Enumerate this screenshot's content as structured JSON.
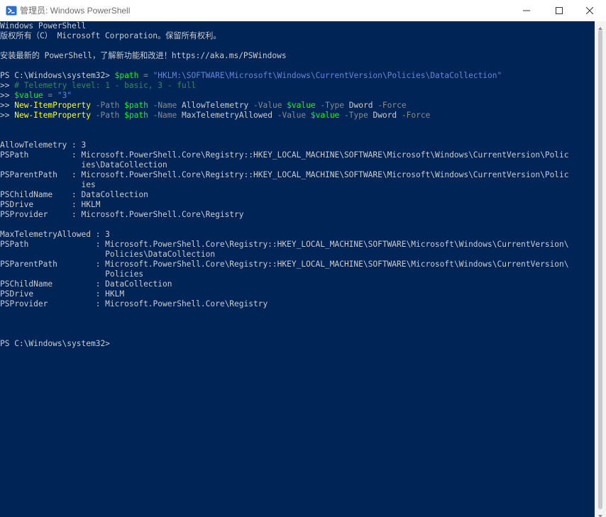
{
  "window": {
    "title": "管理员: Windows PowerShell",
    "controls": {
      "minimize": "minimize",
      "maximize": "maximize",
      "close": "close"
    }
  },
  "console": {
    "header": [
      "Windows PowerShell",
      "版权所有（C） Microsoft Corporation。保留所有权利。",
      "",
      "安装最新的 PowerShell，了解新功能和改进！https://aka.ms/PSWindows",
      ""
    ],
    "commands": {
      "prompt": "PS C:\\Windows\\system32> ",
      "continuation": ">> ",
      "line1": {
        "var": "$path",
        "op": " = ",
        "str": "\"HKLM:\\SOFTWARE\\Microsoft\\Windows\\CurrentVersion\\Policies\\DataCollection\""
      },
      "line2": {
        "comment": "# Telemetry level: 1 - basic, 3 - full"
      },
      "line3": {
        "var": "$value",
        "op": " = ",
        "str": "\"3\""
      },
      "line4": {
        "cmd": "New-ItemProperty",
        "p1": " -Path ",
        "v1": "$path",
        "p2": " -Name ",
        "name": "AllowTelemetry",
        "p3": " -Value ",
        "v2": "$value",
        "p4": " -Type ",
        "type": "Dword",
        "p5": " -Force"
      },
      "line5": {
        "cmd": "New-ItemProperty",
        "p1": " -Path ",
        "v1": "$path",
        "p2": " -Name ",
        "name": "MaxTelemetryAllowed",
        "p3": " -Value ",
        "v2": "$value",
        "p4": " -Type ",
        "type": "Dword",
        "p5": " -Force"
      }
    },
    "output": [
      "",
      "",
      "AllowTelemetry : 3",
      "PSPath         : Microsoft.PowerShell.Core\\Registry::HKEY_LOCAL_MACHINE\\SOFTWARE\\Microsoft\\Windows\\CurrentVersion\\Polic",
      "                 ies\\DataCollection",
      "PSParentPath   : Microsoft.PowerShell.Core\\Registry::HKEY_LOCAL_MACHINE\\SOFTWARE\\Microsoft\\Windows\\CurrentVersion\\Polic",
      "                 ies",
      "PSChildName    : DataCollection",
      "PSDrive        : HKLM",
      "PSProvider     : Microsoft.PowerShell.Core\\Registry",
      "",
      "MaxTelemetryAllowed : 3",
      "PSPath              : Microsoft.PowerShell.Core\\Registry::HKEY_LOCAL_MACHINE\\SOFTWARE\\Microsoft\\Windows\\CurrentVersion\\",
      "                      Policies\\DataCollection",
      "PSParentPath        : Microsoft.PowerShell.Core\\Registry::HKEY_LOCAL_MACHINE\\SOFTWARE\\Microsoft\\Windows\\CurrentVersion\\",
      "                      Policies",
      "PSChildName         : DataCollection",
      "PSDrive             : HKLM",
      "PSProvider          : Microsoft.PowerShell.Core\\Registry",
      "",
      "",
      "",
      "PS C:\\Windows\\system32>"
    ]
  },
  "colors": {
    "background": "#012456",
    "text": "#cccccc",
    "command": "#ffff00",
    "variable": "#00ff00",
    "string": "#5f87d7",
    "parameter": "#8a8a8a",
    "comment": "#2e8b57"
  },
  "icons": {
    "app": "powershell-icon",
    "minimize": "minimize-icon",
    "maximize": "maximize-icon",
    "close": "close-icon"
  }
}
